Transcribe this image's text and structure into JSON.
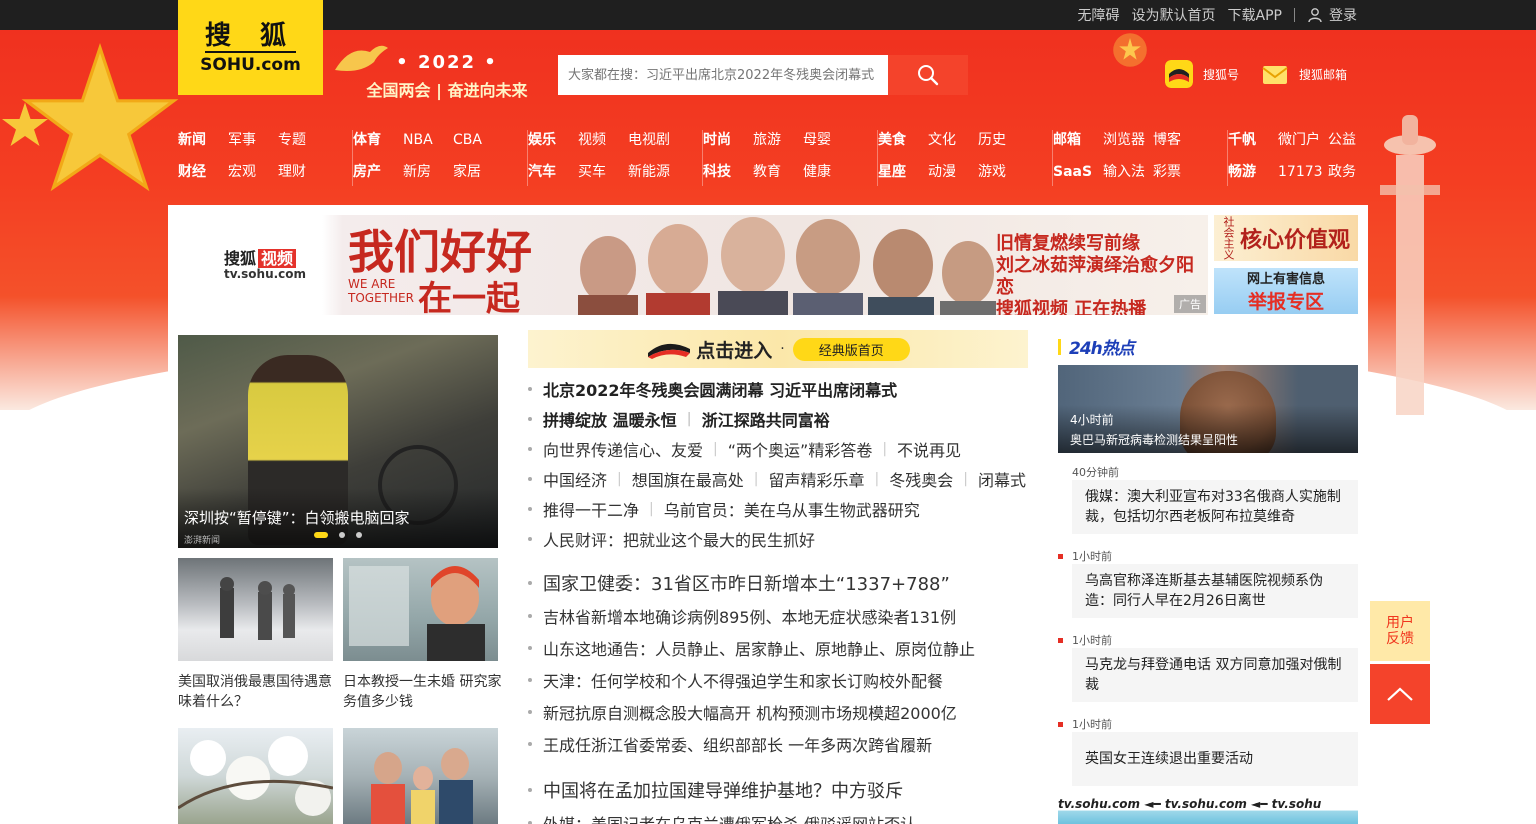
{
  "topbar": {
    "links": [
      "无障碍",
      "设为默认首页",
      "下载APP"
    ],
    "login": "登录"
  },
  "logo": {
    "cn": "搜 狐",
    "en": "SOHU.com"
  },
  "banner": {
    "year": "• 2022 •",
    "slogan": "全国两会 | 奋进向未来"
  },
  "search": {
    "placeholder": "大家都在搜：习近平出席北京2022年冬残奥会闭幕式"
  },
  "header_links": {
    "sohuhao": "搜狐号",
    "mail": "搜狐邮箱"
  },
  "nav": [
    {
      "r1": [
        "新闻",
        "军事",
        "专题"
      ],
      "r2": [
        "财经",
        "宏观",
        "理财"
      ]
    },
    {
      "r1": [
        "体育",
        "NBA",
        "CBA"
      ],
      "r2": [
        "房产",
        "新房",
        "家居"
      ]
    },
    {
      "r1": [
        "娱乐",
        "视频",
        "电视剧"
      ],
      "r2": [
        "汽车",
        "买车",
        "新能源"
      ]
    },
    {
      "r1": [
        "时尚",
        "旅游",
        "母婴"
      ],
      "r2": [
        "科技",
        "教育",
        "健康"
      ]
    },
    {
      "r1": [
        "美食",
        "文化",
        "历史"
      ],
      "r2": [
        "星座",
        "动漫",
        "游戏"
      ]
    },
    {
      "r1": [
        "邮箱",
        "浏览器",
        "博客"
      ],
      "r2": [
        "SaaS",
        "输入法",
        "彩票"
      ]
    },
    {
      "r1": [
        "千帆",
        "微门户",
        "公益"
      ],
      "r2": [
        "畅游",
        "17173",
        "政务"
      ]
    }
  ],
  "ad": {
    "brand": "搜狐",
    "brand_badge": "视频",
    "brand_url": "tv.sohu.com",
    "headline1": "我们好好",
    "headline2": "在一起",
    "we": "WE ARE",
    "together": "TOGETHER",
    "right1": "旧情复燃续写前缘",
    "right2": "刘之冰茹萍演绎治愈夕阳恋",
    "right3": "搜狐视频 正在热播",
    "tag": "广告"
  },
  "side_banners": {
    "b1_vertical": "社会主义",
    "b1_title": "核心价值观",
    "b2_line1": "网上有害信息",
    "b2_line2": "举报专区"
  },
  "carousel": {
    "title": "深圳按“暂停键”：白领搬电脑回家",
    "source": "澎湃新闻"
  },
  "thumbs": [
    {
      "caption": "美国取消俄最惠国待遇意味着什么？"
    },
    {
      "caption": "日本教授一生未婚 研究家务值多少钱"
    }
  ],
  "classic": {
    "enter": "点击进入",
    "dot": "·",
    "button": "经典版首页"
  },
  "news": {
    "r1": [
      "北京2022年冬残奥会圆满闭幕 习近平出席闭幕式"
    ],
    "r2": [
      "拼搏绽放 温暖永恒",
      "浙江探路共同富裕"
    ],
    "r3": [
      "向世界传递信心、友爱",
      "“两个奥运”精彩答卷",
      "不说再见"
    ],
    "r4": [
      "中国经济",
      "想国旗在最高处",
      "留声精彩乐章",
      "冬残奥会",
      "闭幕式"
    ],
    "r5": [
      "推得一干二净",
      "乌前官员：美在乌从事生物武器研究"
    ],
    "r6": [
      "人民财评：把就业这个最大的民生抓好"
    ],
    "r7": [
      "国家卫健委：31省区市昨日新增本土“1337+788”"
    ],
    "r8": [
      "吉林省新增本地确诊病例895例、本地无症状感染者131例"
    ],
    "r9": [
      "山东这地通告：人员静止、居家静止、原地静止、原岗位静止"
    ],
    "r10": [
      "天津：任何学校和个人不得强迫学生和家长订购校外配餐"
    ],
    "r11": [
      "新冠抗原自测概念股大幅高开 机构预测市场规模超2000亿"
    ],
    "r12": [
      "王成任浙江省委常委、组织部部长 一年多两次跨省履新"
    ],
    "r13": [
      "中国将在孟加拉国建导弹维护基地？中方驳斥"
    ],
    "r14": [
      "外媒：美国记者在乌克兰遭俄军枪杀 俄驳谣网站否认"
    ]
  },
  "hot": {
    "title": "24h热点",
    "top_time": "4小时前",
    "top_text": "奥巴马新冠病毒检测结果呈阳性",
    "items": [
      {
        "time": "40分钟前",
        "text": "俄媒：澳大利亚宣布对33名俄商人实施制裁，包括切尔西老板阿布拉莫维奇"
      },
      {
        "time": "1小时前",
        "text": "乌高官称泽连斯基去基辅医院视频系伪造：同行人早在2月26日离世"
      },
      {
        "time": "1小时前",
        "text": "马克龙与拜登通电话 双方同意加强对俄制裁"
      },
      {
        "time": "1小时前",
        "text": "英国女王连续退出重要活动"
      }
    ],
    "tv_strip": "tv.sohu.com ◄━ tv.sohu.com ◄━ tv.sohu"
  },
  "float": {
    "feedback1": "用户",
    "feedback2": "反馈"
  },
  "colors": {
    "brand_red": "#f4432b",
    "logo_yellow": "#ffd817",
    "topbar": "#1f1f1f"
  }
}
